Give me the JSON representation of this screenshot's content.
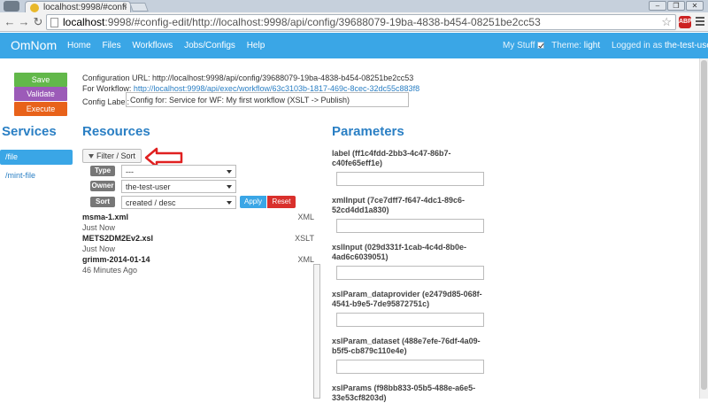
{
  "browser": {
    "tab_title": "localhost:9998/#confi",
    "url_host": "localhost",
    "url_rest": ":9998/#config-edit/http://localhost:9998/api/config/39688079-19ba-4838-b454-08251be2cc53",
    "extension_label": "ABP"
  },
  "navbar": {
    "brand": "OmNom",
    "links": [
      "Home",
      "Files",
      "Workflows",
      "Jobs/Configs",
      "Help"
    ],
    "my_stuff_label": "My Stuff",
    "theme_label": "Theme:",
    "theme_value": "light",
    "logged_in_label": "Logged in as",
    "username": "the-test-user"
  },
  "actions": {
    "save": "Save",
    "validate": "Validate",
    "execute": "Execute"
  },
  "config": {
    "url_label": "Configuration URL: http://localhost:9998/api/config/39688079-19ba-4838-b454-08251be2cc53",
    "workflow_prefix": "For Workflow:",
    "workflow_link": "http://localhost:9998/api/exec/workflow/63c3103b-1817-469c-8cec-32dc55c883f8",
    "label_caption": "Config Label:",
    "label_value": "Config for: Service for WF: My first workflow (XSLT -> Publish)"
  },
  "services": {
    "title": "Services",
    "items": [
      "/file",
      "/mint-file"
    ]
  },
  "resources": {
    "title": "Resources",
    "filter_label": "Filter / Sort",
    "filters": [
      {
        "tag": "Type",
        "value": "---"
      },
      {
        "tag": "Owner",
        "value": "the-test-user"
      },
      {
        "tag": "Sort",
        "value": "created / desc"
      }
    ],
    "apply": "Apply",
    "reset": "Reset",
    "items": [
      {
        "name": "msma-1.xml",
        "type": "XML",
        "time": "Just Now"
      },
      {
        "name": "METS2DM2Ev2.xsl",
        "type": "XSLT",
        "time": "Just Now"
      },
      {
        "name": "grimm-2014-01-14",
        "type": "XML",
        "time": "46 Minutes Ago"
      }
    ]
  },
  "parameters": {
    "title": "Parameters",
    "items": [
      {
        "line1": "label (ff1c4fdd-2bb3-4c47-86b7-",
        "line2": "c40fe65eff1e)"
      },
      {
        "line1": "xmlInput (7ce7dff7-f647-4dc1-89c6-",
        "line2": "52cd4dd1a830)"
      },
      {
        "line1": "xslInput (029d331f-1cab-4c4d-8b0e-",
        "line2": "4ad6c6039051)"
      },
      {
        "line1": "xslParam_dataprovider (e2479d85-068f-",
        "line2": "4541-b9e5-7de95872751c)"
      },
      {
        "line1": "xslParam_dataset (488e7efe-76df-4a09-",
        "line2": "b5f5-cb879c110e4e)"
      },
      {
        "line1": "xslParams (f98bb833-05b5-488e-a6e5-",
        "line2": "33e53cf8203d)"
      }
    ]
  }
}
